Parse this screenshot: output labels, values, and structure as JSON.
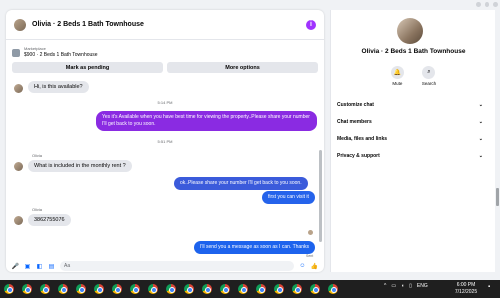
{
  "chat": {
    "title": "Olivia · 2 Beds 1 Bath Townhouse",
    "info_icon": "info-icon",
    "marketplace_label": "Marketplace",
    "marketplace_listing": "$900 · 2 Beds 1 Bath Townhouse",
    "mark_pending": "Mark as pending",
    "more_options": "More options",
    "messages": {
      "m1": "Hi, is this available?",
      "t1": "5:14 PM",
      "m2": "Yes it's Available when you have best time for viewing the property..Please share your number I'll get back to you soon.",
      "t2": "5:51 PM",
      "s1": "Olivia",
      "m3": "What is included in the monthly rent ?",
      "m4": "ok..Please share your number I'll get back to you soon.",
      "m5": "first you can visit it",
      "s2": "Olivia",
      "m6": "3862755076",
      "m7": "I'll send you a message as soon as I can. Thanks",
      "sent": "Sent"
    },
    "composer_placeholder": "Aa"
  },
  "side": {
    "name": "Olivia · 2 Beds 1 Bath Townhouse",
    "mute": "Mute",
    "search": "Search",
    "menu": [
      "Customize chat",
      "Chat members",
      "Media, files and links",
      "Privacy & support"
    ]
  },
  "taskbar": {
    "lang": "ENG",
    "time": "6:00 PM",
    "date": "7/12/2025"
  },
  "colors": {
    "purple_bubble": "#8a2be2",
    "blue_bubble": "#2563eb",
    "accent": "#0866ff"
  }
}
